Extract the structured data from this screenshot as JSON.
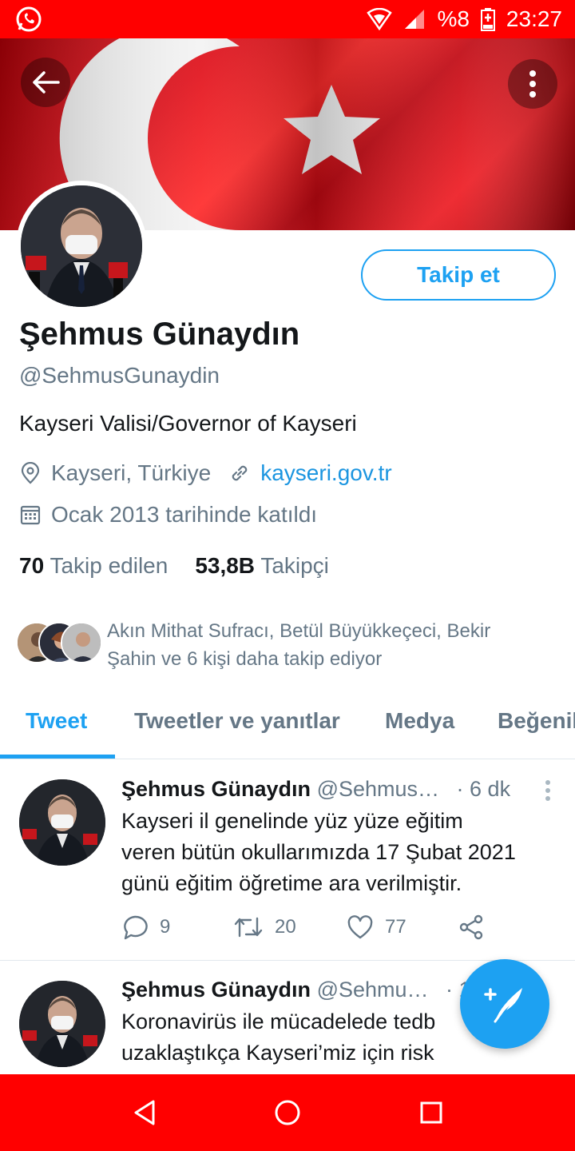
{
  "status_bar": {
    "battery": "%8",
    "time": "23:27",
    "icons": [
      "whatsapp-icon",
      "wifi-icon",
      "cellular-signal-icon",
      "battery-charging-icon"
    ]
  },
  "header": {
    "back_icon": "arrow-left-icon",
    "more_icon": "more-vertical-icon",
    "banner": "turkish-flag-banner"
  },
  "profile": {
    "follow_label": "Takip et",
    "name": "Şehmus Günaydın",
    "handle": "@SehmusGunaydin",
    "bio": "Kayseri Valisi/Governor of Kayseri",
    "location": "Kayseri, Türkiye",
    "website": "kayseri.gov.tr",
    "joined": "Ocak 2013 tarihinde katıldı",
    "following_count": "70",
    "following_label": "Takip edilen",
    "followers_count": "53,8B",
    "followers_label": "Takipçi",
    "mutual_line1": "Akın Mithat Sufracı, Betül Büyükkeçeci, Bekir",
    "mutual_line2": "Şahin ve 6 kişi daha takip ediyor"
  },
  "tabs": [
    {
      "label": "Tweet",
      "active": true
    },
    {
      "label": "Tweetler ve yanıtlar",
      "active": false
    },
    {
      "label": "Medya",
      "active": false
    },
    {
      "label": "Beğenil",
      "active": false
    }
  ],
  "tweets": [
    {
      "name": "Şehmus Günaydın",
      "handle": "@Sehmus…",
      "time": "· 6 dk",
      "lines": [
        "Kayseri il genelinde yüz yüze eğitim",
        "veren bütün okullarımızda 17 Şubat 2021",
        "günü eğitim öğretime ara verilmiştir."
      ],
      "replies": "9",
      "retweets": "20",
      "likes": "77"
    },
    {
      "name": "Şehmus Günaydın",
      "handle": "@Sehmu…",
      "time": "· 1",
      "lines": [
        "Koronavirüs ile mücadelede tedb",
        "uzaklaştıkça Kayseri’miz için risk"
      ]
    }
  ],
  "colors": {
    "accent": "#1da1f2",
    "status_bar": "#ff0000",
    "secondary_text": "#657786"
  }
}
